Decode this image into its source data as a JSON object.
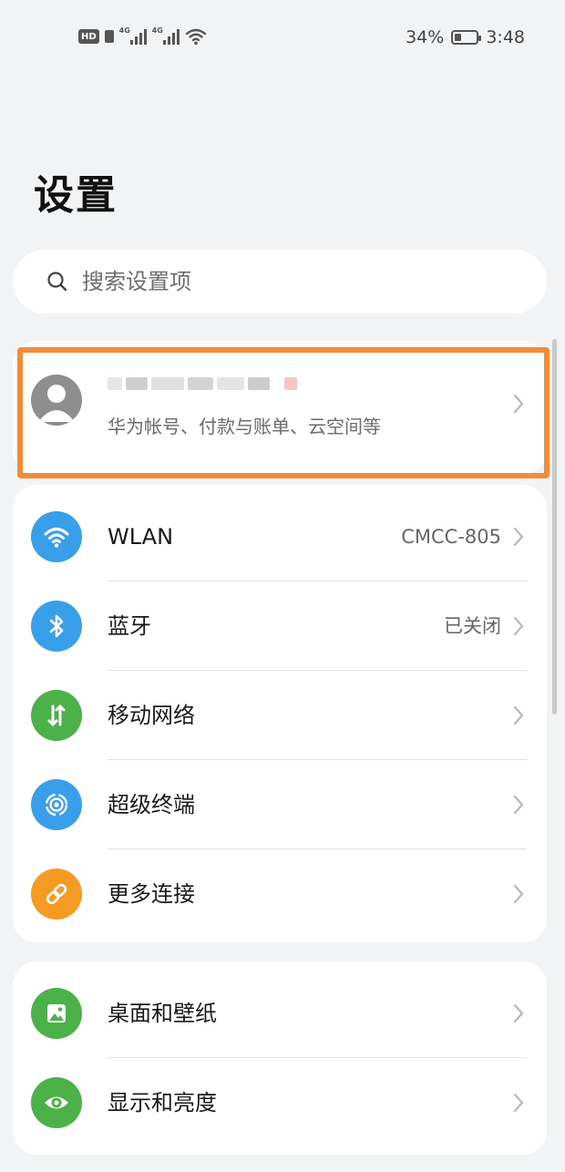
{
  "status_bar": {
    "hd": "HD",
    "net1": "4G",
    "net2": "4G",
    "battery_percent": 34,
    "battery_text": "34%",
    "time": "3:48"
  },
  "page": {
    "title": "设置"
  },
  "search": {
    "placeholder": "搜索设置项",
    "icon": "search-icon"
  },
  "account": {
    "subtitle": "华为帐号、付款与账单、云空间等",
    "highlight_color": "#f68b35"
  },
  "connectivity": {
    "items": [
      {
        "label": "WLAN",
        "value": "CMCC-805",
        "icon": "wifi-icon",
        "color": "#3a9fea"
      },
      {
        "label": "蓝牙",
        "value": "已关闭",
        "icon": "bluetooth-icon",
        "color": "#3a9fea"
      },
      {
        "label": "移动网络",
        "value": "",
        "icon": "mobile-data-icon",
        "color": "#4db14a"
      },
      {
        "label": "超级终端",
        "value": "",
        "icon": "super-device-icon",
        "color": "#3a9fea"
      },
      {
        "label": "更多连接",
        "value": "",
        "icon": "link-icon",
        "color": "#f59a23"
      }
    ]
  },
  "display": {
    "items": [
      {
        "label": "桌面和壁纸",
        "value": "",
        "icon": "wallpaper-icon",
        "color": "#4db14a"
      },
      {
        "label": "显示和亮度",
        "value": "",
        "icon": "eye-icon",
        "color": "#4db14a"
      }
    ]
  }
}
